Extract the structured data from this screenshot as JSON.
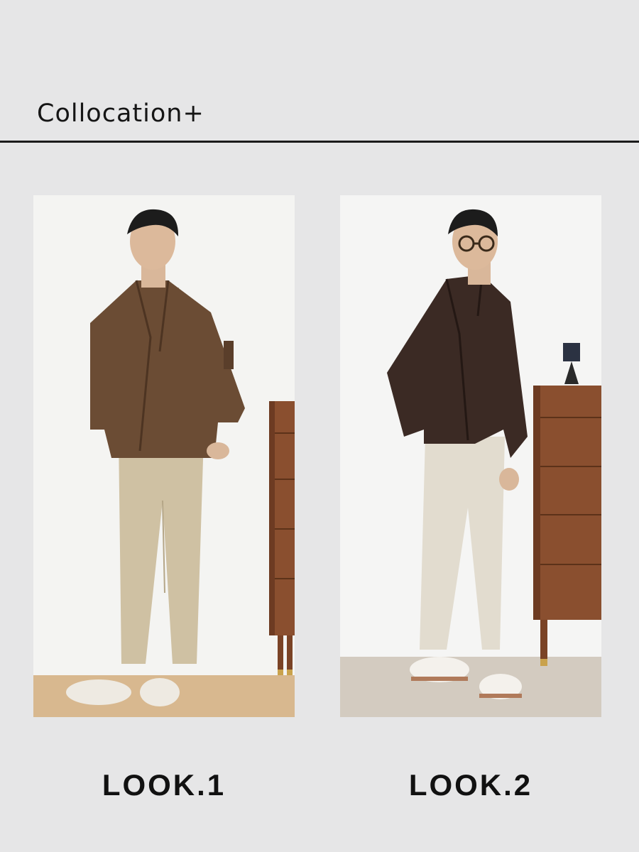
{
  "header": {
    "title": "Collocation+"
  },
  "looks": [
    {
      "label": "LOOK.1",
      "jacket_color": "#6b4c34",
      "sweater_color": "#b7a998",
      "trousers_color": "#cfc1a3",
      "sneaker_color": "#eeeae2",
      "floor_color": "#d8b88f"
    },
    {
      "label": "LOOK.2",
      "jacket_color": "#3b2a24",
      "sweater_color": "#8e7a66",
      "trousers_color": "#e2dccf",
      "sneaker_color": "#f4f1ec",
      "floor_color": "#d3cbc0"
    }
  ],
  "colors": {
    "page_background": "#e6e6e7",
    "divider": "#1b1b1b",
    "dresser_wood": "#8a4f2f"
  }
}
